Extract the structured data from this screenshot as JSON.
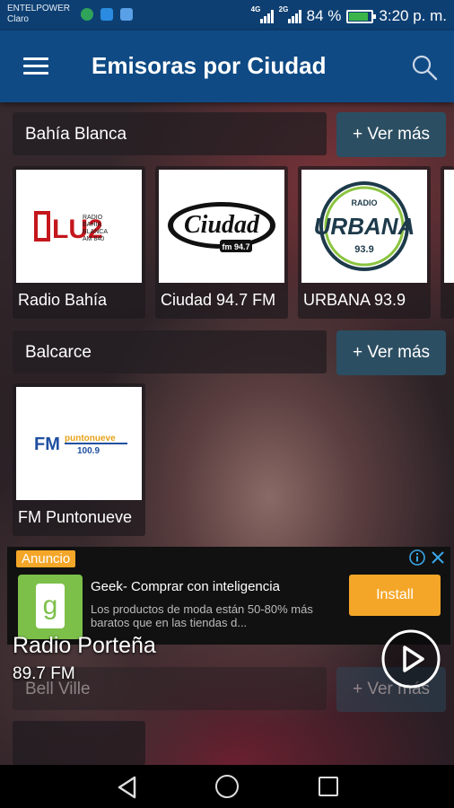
{
  "status_bar": {
    "carrier_1": "ENTELPOWER",
    "carrier_2": "Claro",
    "net_1": "4G",
    "net_2": "2G",
    "battery_text": "84 %",
    "battery_level": 0.84,
    "time": "3:20 p. m."
  },
  "app_bar": {
    "title": "Emisoras por Ciudad",
    "menu_icon": "hamburger-menu-icon",
    "search_icon": "search-icon"
  },
  "sections": [
    {
      "city": "Bahía Blanca",
      "ver_mas": "+ Ver más",
      "stations": [
        {
          "name": "Radio Bahía",
          "logo_text": "LU2",
          "logo_sub": "RADIO BAHIA BLANCA AM 840"
        },
        {
          "name": "Ciudad 94.7 FM",
          "logo_text": "Ciudad",
          "logo_sub": "fm 94.7"
        },
        {
          "name": "URBANA 93.9",
          "logo_text": "URBANA",
          "logo_sub": "93.9",
          "logo_top": "RADIO"
        }
      ]
    },
    {
      "city": "Balcarce",
      "ver_mas": "+ Ver más",
      "stations": [
        {
          "name": "FM Puntonueve",
          "logo_text": "FM",
          "logo_sub": "puntonueve",
          "logo_freq": "100.9"
        }
      ]
    },
    {
      "city": "Bell Ville",
      "ver_mas": "+ Ver más"
    }
  ],
  "ad": {
    "badge": "Anuncio",
    "title": "Geek- Comprar con inteligencia",
    "description": "Los productos de moda están 50-80% más baratos que en las tiendas d...",
    "install": "Install",
    "icon_letter": "g"
  },
  "now_playing": {
    "name": "Radio Porteña",
    "frequency": "89.7 FM"
  },
  "colors": {
    "status_bar": "#0d3f72",
    "app_bar": "#0f4a84",
    "ver_mas_button": "#2c4e62",
    "ad_accent": "#f4a629"
  }
}
